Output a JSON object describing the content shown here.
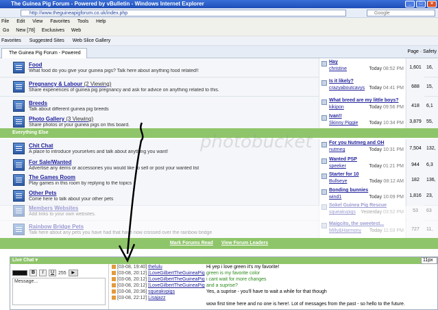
{
  "window": {
    "title": "The Guinea Pig Forum - Powered by vBulletin - Windows Internet Explorer"
  },
  "address": {
    "url": "http://www.theguineapigforum.co.uk/index.php"
  },
  "search": {
    "placeholder": "Google"
  },
  "menu": [
    "File",
    "Edit",
    "View",
    "Favorites",
    "Tools",
    "Help"
  ],
  "toolbar": {
    "go": "Go",
    "new": "New [78]",
    "exclusives": "Exclusives",
    "web": "Web"
  },
  "favorites": {
    "label": "Favorites",
    "suggested": "Suggested Sites",
    "webslice": "Web Slice Gallery"
  },
  "tab": {
    "title": "The Guinea Pig Forum - Powered by vBulletin",
    "page": "Page",
    "safety": "Safety"
  },
  "forums": [
    {
      "title": "Food",
      "viewing": "",
      "desc": "What food do you give your guinea pigs? Talk here about anything food related!!",
      "lp_title": "Hay",
      "lp_by": "christine",
      "lp_date": "Today",
      "lp_time": "08:52 PM",
      "threads": "1,601",
      "posts": "16,"
    },
    {
      "title": "Pregnancy & Labour",
      "viewing": "(2 Viewing)",
      "desc": "Share experiences of guinea pig pregnancy and ask for advice on anything related to this.",
      "lp_title": "Is it likely?",
      "lp_by": "crazyaboutcavys",
      "lp_date": "Today",
      "lp_time": "04:41 PM",
      "threads": "688",
      "posts": "15,"
    },
    {
      "title": "Breeds",
      "viewing": "",
      "desc": "Talk about different guinea pig breeds",
      "lp_title": "What breed are my little boys?",
      "lp_by": "kikipon",
      "lp_date": "Today",
      "lp_time": "09:56 PM",
      "threads": "418",
      "posts": "6,1"
    },
    {
      "title": "Photo Gallery",
      "viewing": "(3 Viewing)",
      "desc": "Share photos of your guinea pigs on this board.",
      "lp_title": "Ivan!!",
      "lp_by": "Skinny Piggie",
      "lp_date": "Today",
      "lp_time": "10:34 PM",
      "threads": "3,879",
      "posts": "55,"
    },
    {
      "title": "Chit Chat",
      "viewing": "",
      "desc": "A place to introduce yourselves and talk about anything you want!",
      "lp_title": "For you Nutmeg and OH",
      "lp_by": "nutmeg",
      "lp_date": "Today",
      "lp_time": "10:31 PM",
      "threads": "7,504",
      "posts": "132,"
    },
    {
      "title": "For Sale/Wanted",
      "viewing": "",
      "desc": "Advertise any items or accessories you would like to sell or post your wanted list",
      "lp_title": "Wanted PSP",
      "lp_by": "speeker",
      "lp_date": "Today",
      "lp_time": "01:21 PM",
      "threads": "944",
      "posts": "6,3"
    },
    {
      "title": "The Games Room",
      "viewing": "",
      "desc": "Play games in this room by replying to the topics",
      "lp_title": "Starter for 10",
      "lp_by": "Bullseye",
      "lp_date": "Today",
      "lp_time": "08:12 AM",
      "threads": "182",
      "posts": "136,"
    },
    {
      "title": "Other Pets",
      "viewing": "",
      "desc": "Come here to talk about your other pets",
      "lp_title": "Bonding bunnies",
      "lp_by": "wind1",
      "lp_date": "Today",
      "lp_time": "10:09 PM",
      "threads": "1,816",
      "posts": "23,"
    },
    {
      "title": "Members Websites",
      "viewing": "",
      "desc": "Add links to your own websites.",
      "lp_title": "Sokel Guinea Pig Rescue",
      "lp_by": "squeakvpigs",
      "lp_date": "Yesterday",
      "lp_time": "03:52 PM",
      "threads": "53",
      "posts": "63"
    },
    {
      "title": "Rainbow Bridge Pets",
      "viewing": "",
      "desc": "Talk here about any pets you have had that have now crossed over the rainbow bridge",
      "lp_title": "Maigcito, the sweetest...",
      "lp_by": "Milly&Harmony",
      "lp_date": "Today",
      "lp_time": "11:03 PM",
      "threads": "727",
      "posts": "11,"
    }
  ],
  "section": {
    "label": "Everything Else"
  },
  "footer": {
    "mark": "Mark Forums Read",
    "leaders": "View Forum Leaders"
  },
  "chat": {
    "title": "Live Chat ▾",
    "font_size": "11px",
    "counter": "255",
    "input_placeholder": "Message...",
    "messages": [
      {
        "time": "[03-08, 19:40]",
        "user": "thelulu",
        "text": "Hi yep i love green it's my favorite!",
        "green": false
      },
      {
        "time": "[03-08, 20:12]",
        "user": "[LoveGilbertTheGuineaPig",
        "text": "green is my favorite color",
        "green": true
      },
      {
        "time": "[03-08, 20:12]",
        "user": "[LoveGilbertTheGuineaPig",
        "text": "i cant wait for more changes",
        "green": true
      },
      {
        "time": "[03-08, 20:12]",
        "user": "[LoveGilbertTheGuineaPig",
        "text": "and a suprise?",
        "green": true
      },
      {
        "time": "[03-08, 20:36]",
        "user": "squeakvpigs",
        "text": "Yes, a suprise - you'll have to wait a while for that though",
        "green": false
      },
      {
        "time": "[03-08, 22:12]",
        "user": "Lisajazz",
        "text": "wow first time here and no one is here!. Lot of messages from the past - so hello to the future.",
        "green": false
      }
    ]
  },
  "watermark": "photobucket"
}
